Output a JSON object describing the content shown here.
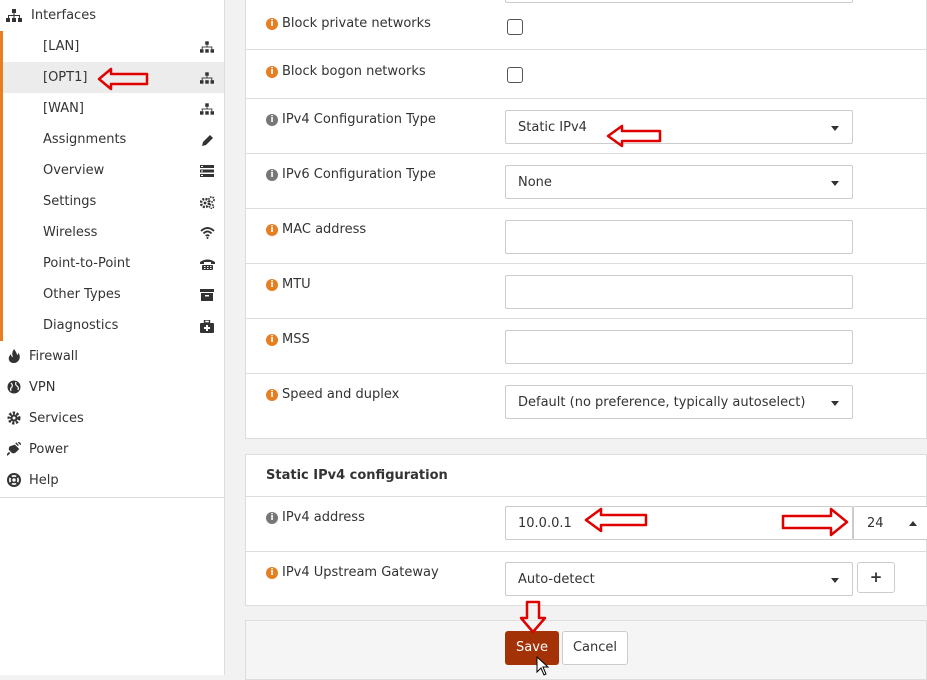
{
  "sidebar": {
    "interfaces_label": "Interfaces",
    "submenu": [
      {
        "label": "[LAN]",
        "icon": "sitemap-icon"
      },
      {
        "label": "[OPT1]",
        "icon": "sitemap-icon",
        "active": true
      },
      {
        "label": "[WAN]",
        "icon": "sitemap-icon"
      },
      {
        "label": "Assignments",
        "icon": "pencil-icon"
      },
      {
        "label": "Overview",
        "icon": "list-icon"
      },
      {
        "label": "Settings",
        "icon": "gears-icon"
      },
      {
        "label": "Wireless",
        "icon": "wifi-icon"
      },
      {
        "label": "Point-to-Point",
        "icon": "phone-icon"
      },
      {
        "label": "Other Types",
        "icon": "archive-icon"
      },
      {
        "label": "Diagnostics",
        "icon": "medkit-icon"
      }
    ],
    "main": [
      {
        "label": "Firewall",
        "icon": "fire-icon"
      },
      {
        "label": "VPN",
        "icon": "globe-icon"
      },
      {
        "label": "Services",
        "icon": "cog-icon"
      },
      {
        "label": "Power",
        "icon": "plug-icon"
      },
      {
        "label": "Help",
        "icon": "lifebuoy-icon"
      }
    ]
  },
  "form": {
    "block_private": "Block private networks",
    "block_bogon": "Block bogon networks",
    "ipv4_type_label": "IPv4 Configuration Type",
    "ipv4_type_value": "Static IPv4",
    "ipv6_type_label": "IPv6 Configuration Type",
    "ipv6_type_value": "None",
    "mac_label": "MAC address",
    "mtu_label": "MTU",
    "mss_label": "MSS",
    "speed_label": "Speed and duplex",
    "speed_value": "Default (no preference, typically autoselect)"
  },
  "static_ipv4": {
    "title": "Static IPv4 configuration",
    "address_label": "IPv4 address",
    "address_value": "10.0.0.1",
    "cidr_value": "24",
    "gateway_label": "IPv4 Upstream Gateway",
    "gateway_value": "Auto-detect",
    "add_label": "+"
  },
  "buttons": {
    "save": "Save",
    "cancel": "Cancel"
  },
  "colors": {
    "accent": "#e67e22",
    "save": "#a33306",
    "annotation": "#e00000"
  }
}
